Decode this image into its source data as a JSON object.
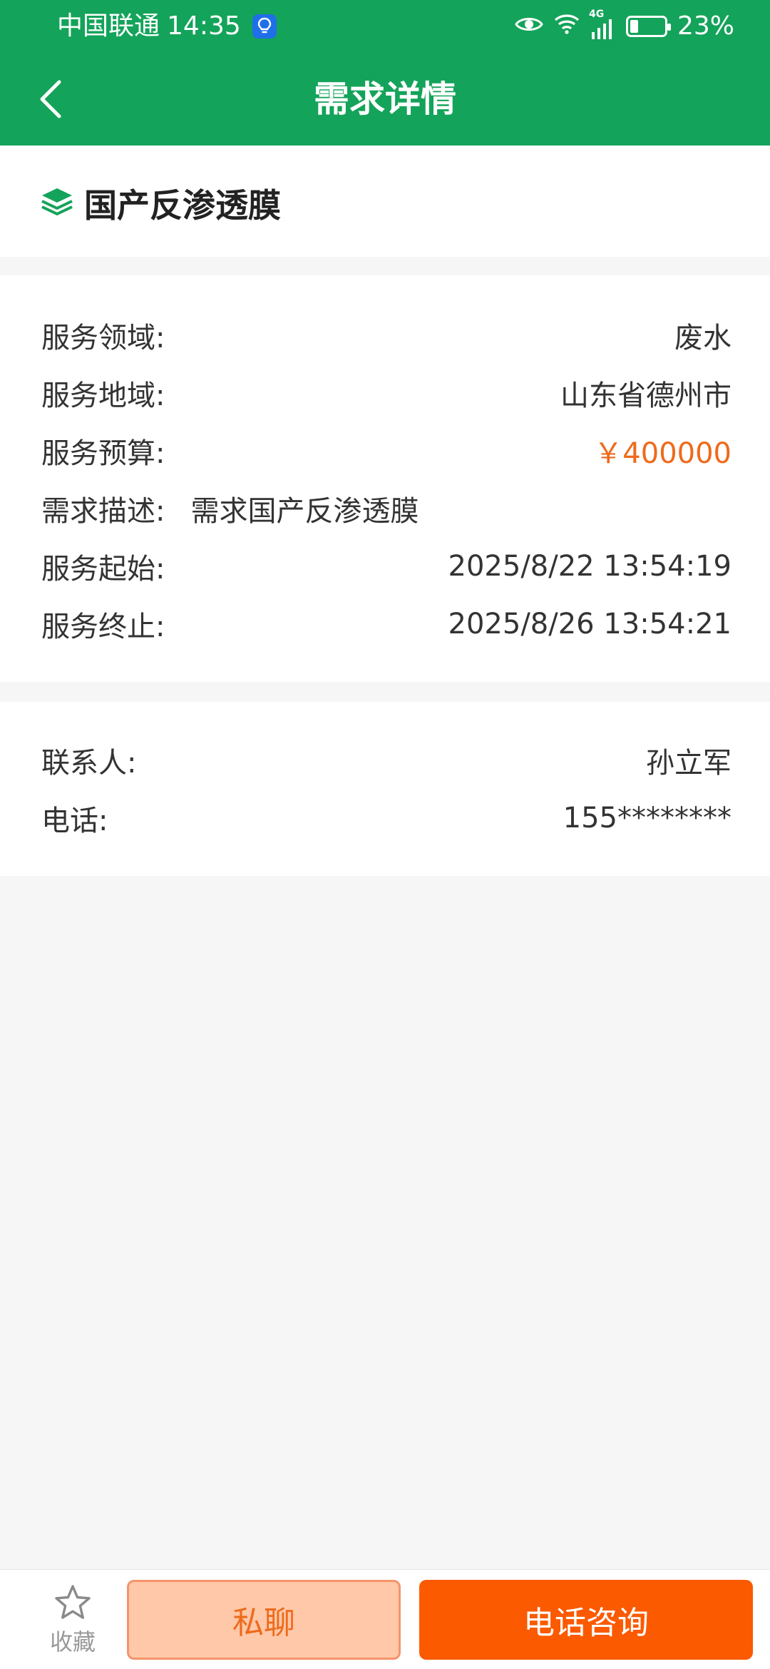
{
  "status_bar": {
    "carrier": "中国联通",
    "time": "14:35",
    "network": "4G",
    "battery_percent": "23%",
    "battery_level": 0.23,
    "icons": [
      "lightbulb-icon",
      "eye-icon",
      "wifi-icon",
      "signal-icon",
      "battery-icon"
    ]
  },
  "header": {
    "title": "需求详情",
    "back_icon": "chevron-left-icon",
    "background_color": "#14a35a"
  },
  "item": {
    "icon": "layers-icon",
    "title": "国产反渗透膜"
  },
  "details": [
    {
      "label": "服务领域:",
      "value": "废水"
    },
    {
      "label": "服务地域:",
      "value": "山东省德州市"
    },
    {
      "label": "服务预算:",
      "value": "￥400000"
    },
    {
      "label": "需求描述:",
      "value": "需求国产反渗透膜"
    },
    {
      "label": "服务起始:",
      "value": "2025/8/22 13:54:19"
    },
    {
      "label": "服务终止:",
      "value": "2025/8/26 13:54:21"
    }
  ],
  "contact": [
    {
      "label": "联系人:",
      "value": "孙立军"
    },
    {
      "label": "电话:",
      "value": "155********"
    }
  ],
  "bottom_bar": {
    "favorite_label": "收藏",
    "favorite_icon": "star-outline-icon",
    "chat_label": "私聊",
    "call_label": "电话咨询",
    "accent_color": "#fb5a00",
    "price_color": "#ee6a1c"
  }
}
